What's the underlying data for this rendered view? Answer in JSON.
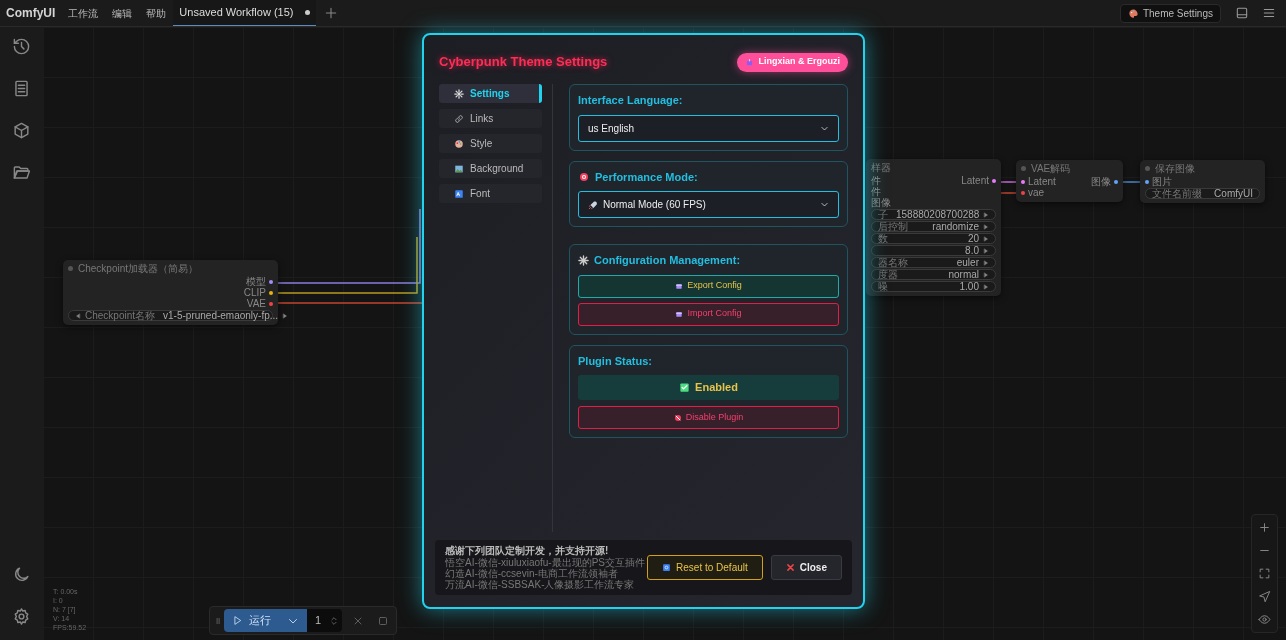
{
  "app": {
    "title": "ComfyUI"
  },
  "menu": [
    "工作流",
    "编辑",
    "帮助"
  ],
  "tabs": [
    {
      "label": "Unsaved Workflow (15)",
      "selected": true,
      "modified": true
    }
  ],
  "theme_button": "Theme Settings",
  "nodes": [
    {
      "title": "Checkpoint加载器（简易）",
      "outputs": [
        {
          "label": "模型",
          "color": "#a78bfa"
        },
        {
          "label": "CLIP",
          "color": "#eab308"
        },
        {
          "label": "VAE",
          "color": "#ef4444"
        }
      ],
      "widgets": [
        {
          "label": "Checkpoint名称",
          "value": "v1-5-pruned-emaonly-fp..."
        }
      ]
    },
    {
      "title": "样器",
      "inputs": [
        {
          "label": "件"
        },
        {
          "label": "件"
        },
        {
          "label": "图像"
        }
      ],
      "outputs": [
        {
          "label": "Latent",
          "color": "#e879f9"
        }
      ],
      "widgets": [
        {
          "label": "子",
          "value": "158880208700288"
        },
        {
          "label": "后控制",
          "value": "randomize"
        },
        {
          "label": "数",
          "value": "20"
        },
        {
          "value": "8.0"
        },
        {
          "label": "器名称",
          "value": "euler"
        },
        {
          "label": "度器",
          "value": "normal"
        },
        {
          "label": "噪",
          "value": "1.00"
        }
      ]
    },
    {
      "title": "VAE解码",
      "inputs": [
        {
          "label": "Latent",
          "color": "#e879f9"
        },
        {
          "label": "vae",
          "color": "#ef4444"
        }
      ],
      "outputs": [
        {
          "label": "图像",
          "color": "#60a5fa"
        }
      ]
    },
    {
      "title": "保存图像",
      "inputs": [
        {
          "label": "图片",
          "color": "#60a5fa"
        }
      ],
      "widgets": [
        {
          "label": "文件名前缀",
          "value": "ComfyUI"
        }
      ]
    }
  ],
  "stats": [
    "T: 0.00s",
    "I: 0",
    "N: 7 [7]",
    "V: 14",
    "FPS:59.52"
  ],
  "run_bar": {
    "run": "运行",
    "count": "1"
  },
  "dialog": {
    "title": "Cyberpunk Theme Settings",
    "badge": "Lingxian & Ergouzi",
    "nav": [
      {
        "label": "Settings",
        "selected": true
      },
      {
        "label": "Links",
        "selected": false
      },
      {
        "label": "Style",
        "selected": false
      },
      {
        "label": "Background",
        "selected": false
      },
      {
        "label": "Font",
        "selected": false
      }
    ],
    "language": {
      "label": "Interface Language:",
      "value": "us English"
    },
    "performance": {
      "label": "Performance Mode:",
      "value": "Normal Mode (60 FPS)"
    },
    "config": {
      "label": "Configuration Management:",
      "export": "Export Config",
      "import": "Import Config"
    },
    "plugin": {
      "label": "Plugin Status:",
      "enabled": true,
      "status": "Enabled",
      "toggle": "Disable Plugin"
    },
    "footer": {
      "heading": "感谢下列团队定制开发，并支持开源!",
      "lines": [
        "悟空AI-微信-xiuluxiaofu-最出现的PS交互插件",
        "幻造AI-微信-ccsevin-电商工作流领袖者",
        "万流AI-微信-SSBSAK-人像摄影工作流专家"
      ]
    },
    "reset": "Reset to Default",
    "close": "Close"
  }
}
